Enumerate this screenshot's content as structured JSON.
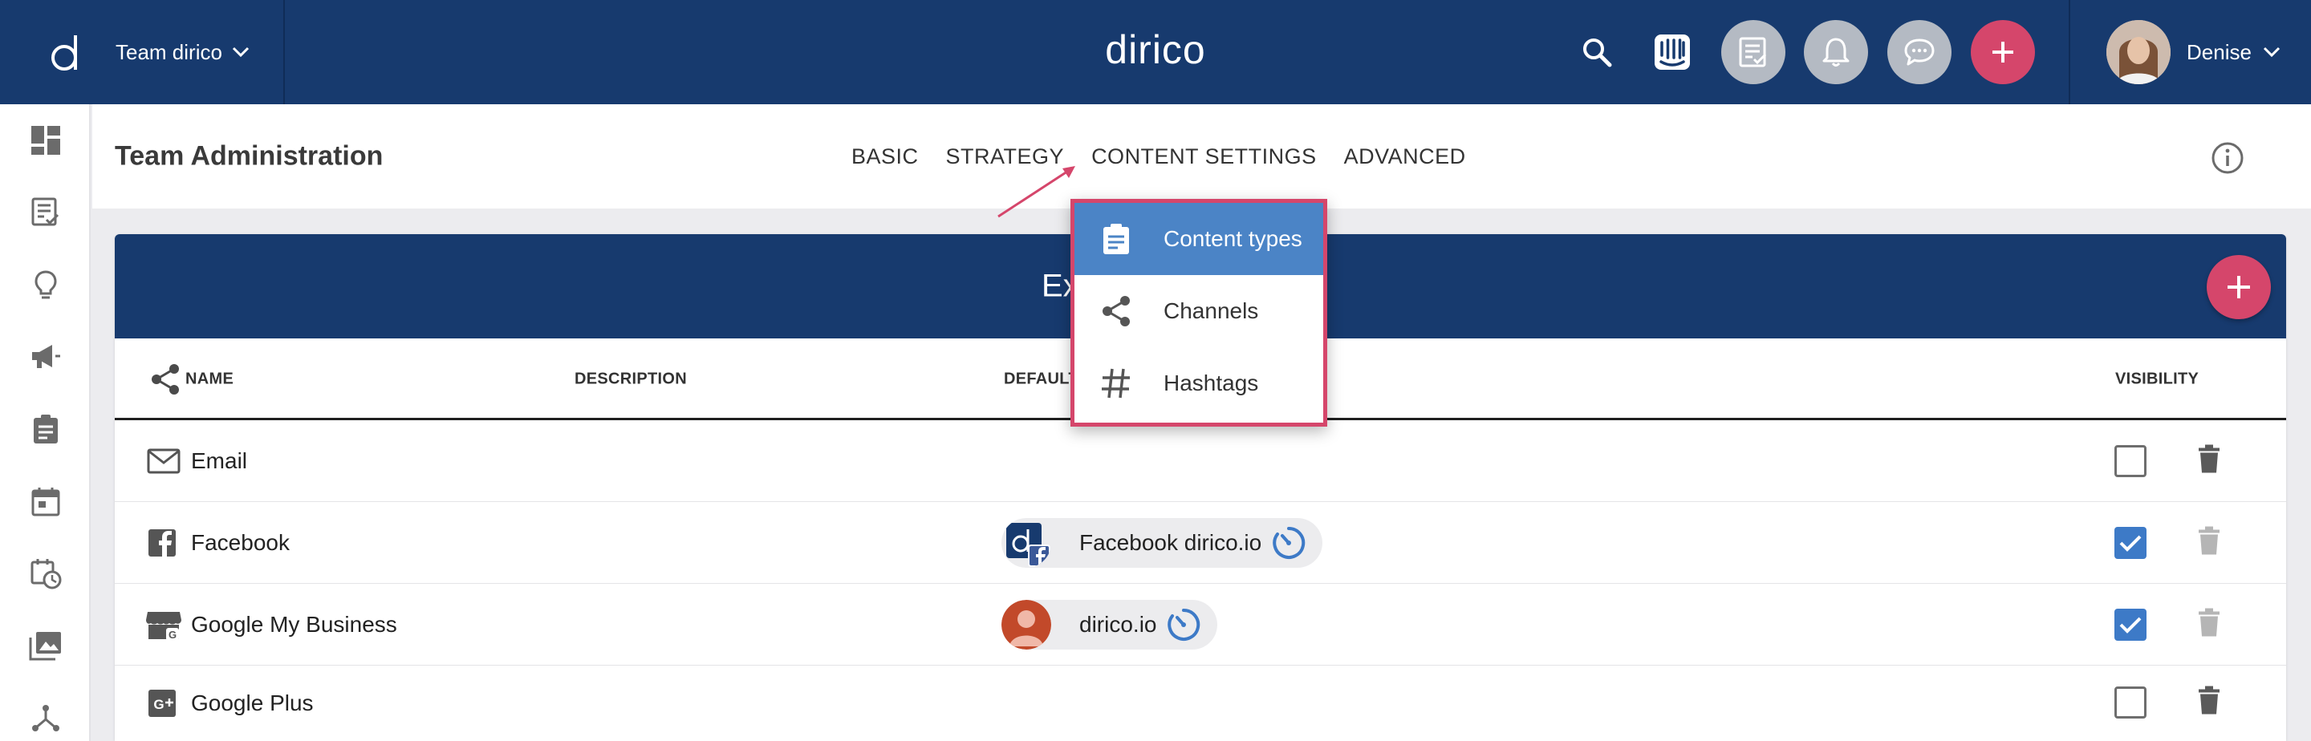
{
  "topbar": {
    "team_name": "Team dirico",
    "team_logo_letter": "d",
    "brand": "dirico",
    "icons": [
      "search-icon",
      "intercom-icon",
      "tasks-icon",
      "bell-icon",
      "chat-icon",
      "plus-icon"
    ],
    "user_name": "Denise"
  },
  "sidebar": {
    "items": [
      "dashboard-icon",
      "content-icon",
      "ideas-icon",
      "campaigns-icon",
      "tasks-icon",
      "calendar-icon",
      "schedule-icon",
      "media-icon",
      "workflow-icon"
    ]
  },
  "header": {
    "title": "Team Administration",
    "tabs": [
      "BASIC",
      "STRATEGY",
      "CONTENT SETTINGS",
      "ADVANCED"
    ]
  },
  "card": {
    "title": "Exis",
    "columns": {
      "name": "NAME",
      "description": "DESCRIPTION",
      "default": "DEFAULT",
      "visibility": "VISIBILITY"
    },
    "rows": [
      {
        "name": "Email",
        "icon": "email-icon",
        "default": "",
        "visible": false
      },
      {
        "name": "Facebook",
        "icon": "facebook-icon",
        "default": "Facebook dirico.io",
        "visible": true
      },
      {
        "name": "Google My Business",
        "icon": "google-my-business-icon",
        "default": "dirico.io",
        "visible": true
      },
      {
        "name": "Google Plus",
        "icon": "google-plus-icon",
        "default": "",
        "visible": false
      }
    ]
  },
  "dropdown": {
    "items": [
      {
        "label": "Content types",
        "icon": "clipboard-icon",
        "active": true
      },
      {
        "label": "Channels",
        "icon": "share-icon",
        "active": false
      },
      {
        "label": "Hashtags",
        "icon": "hashtag-icon",
        "active": false
      }
    ]
  },
  "colors": {
    "navy": "#173a6e",
    "accent_pink": "#d5466b",
    "active_blue": "#4b84c6",
    "checkbox_blue": "#3d7ac7"
  }
}
